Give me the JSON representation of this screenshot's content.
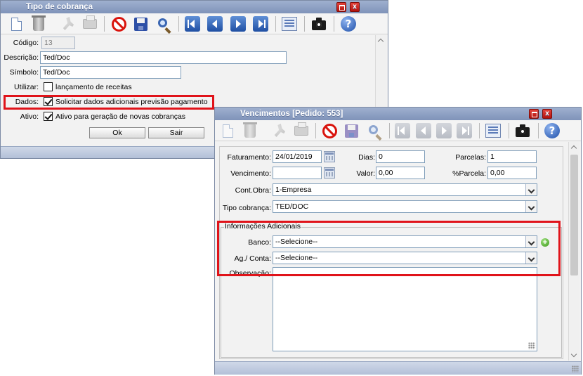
{
  "window1": {
    "title": "Tipo de cobrança",
    "fields": {
      "codigo_label": "Código:",
      "codigo_value": "13",
      "descricao_label": "Descrição:",
      "descricao_value": "Ted/Doc",
      "simbolo_label": "Símbolo:",
      "simbolo_value": "Ted/Doc",
      "utilizar_label": "Utilizar:",
      "utilizar_option": "lançamento de receitas",
      "dados_label": "Dados:",
      "dados_option": "Solicitar dados adicionais previsão pagamento",
      "ativo_label": "Ativo:",
      "ativo_option": "Ativo para geração de novas cobranças"
    },
    "buttons": {
      "ok": "Ok",
      "sair": "Sair"
    },
    "close_glyph": "x"
  },
  "window2": {
    "title": "Vencimentos [Pedido: 553]",
    "fields": {
      "faturamento_label": "Faturamento:",
      "faturamento_value": "24/01/2019",
      "dias_label": "Dias:",
      "dias_value": "0",
      "parcelas_label": "Parcelas:",
      "parcelas_value": "1",
      "vencimento_label": "Vencimento:",
      "vencimento_value": "",
      "valor_label": "Valor:",
      "valor_value": "0,00",
      "pct_parcela_label": "%Parcela:",
      "pct_parcela_value": "0,00",
      "cont_obra_label": "Cont.Obra:",
      "cont_obra_value": "1-Empresa",
      "tipo_cobranca_label": "Tipo cobrança:",
      "tipo_cobranca_value": "TED/DOC"
    },
    "info": {
      "legend": "Informações Adicionais",
      "banco_label": "Banco:",
      "banco_value": "--Selecione--",
      "agconta_label": "Ag./ Conta:",
      "agconta_value": "--Selecione--",
      "observacao_label": "Observação:",
      "observacao_value": ""
    },
    "close_glyph": "x",
    "add_glyph": "+"
  },
  "toolbar_icons": [
    "new-icon",
    "delete-icon",
    "tools-icon",
    "print-icon",
    "cancel-icon",
    "save-icon",
    "search-icon",
    "first-icon",
    "previous-icon",
    "next-icon",
    "last-icon",
    "report-icon",
    "camera-icon",
    "help-icon"
  ],
  "help_glyph": "?",
  "colors": {
    "title_bar": "#8a9dc2",
    "highlight_box": "#e0131a",
    "nav_blue": "#2457ad"
  }
}
